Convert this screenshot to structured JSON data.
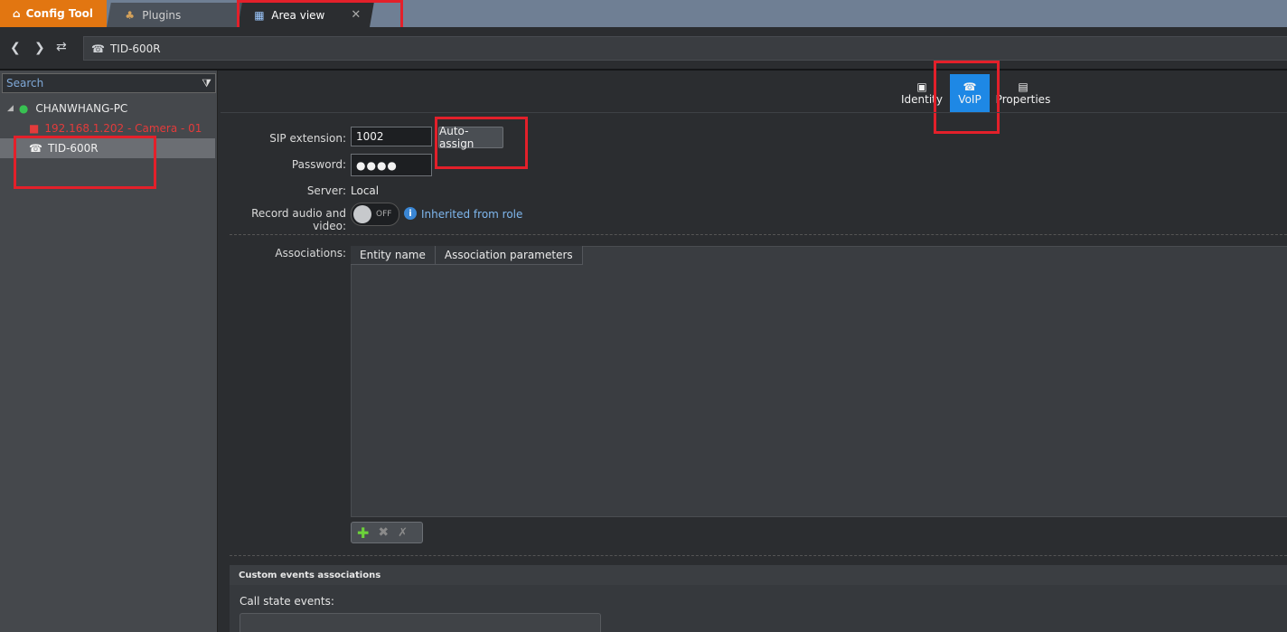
{
  "tabs": {
    "config_tool": "Config Tool",
    "plugins": "Plugins",
    "area_view": "Area view"
  },
  "address": {
    "entity": "TID-600R"
  },
  "sidebar": {
    "search_placeholder": "Search",
    "root": "CHANWHANG-PC",
    "camera": "192.168.1.202 - Camera - 01",
    "selected": "TID-600R"
  },
  "page_tabs": {
    "identity": "Identity",
    "voip": "VoIP",
    "properties": "Properties"
  },
  "form": {
    "sip_label": "SIP extension:",
    "sip_value": "1002",
    "auto_assign": "Auto-assign",
    "password_label": "Password:",
    "password_value": "●●●●",
    "server_label": "Server:",
    "server_value": "Local",
    "record_label": "Record audio and video:",
    "toggle_state": "OFF",
    "inherited": "Inherited from role",
    "associations_label": "Associations:",
    "col_entity": "Entity name",
    "col_params": "Association parameters"
  },
  "custom": {
    "header": "Custom events associations",
    "call_state": "Call state events:"
  },
  "colors": {
    "accent": "#1e88e5",
    "brand": "#e27611",
    "alert": "#e3202a"
  }
}
